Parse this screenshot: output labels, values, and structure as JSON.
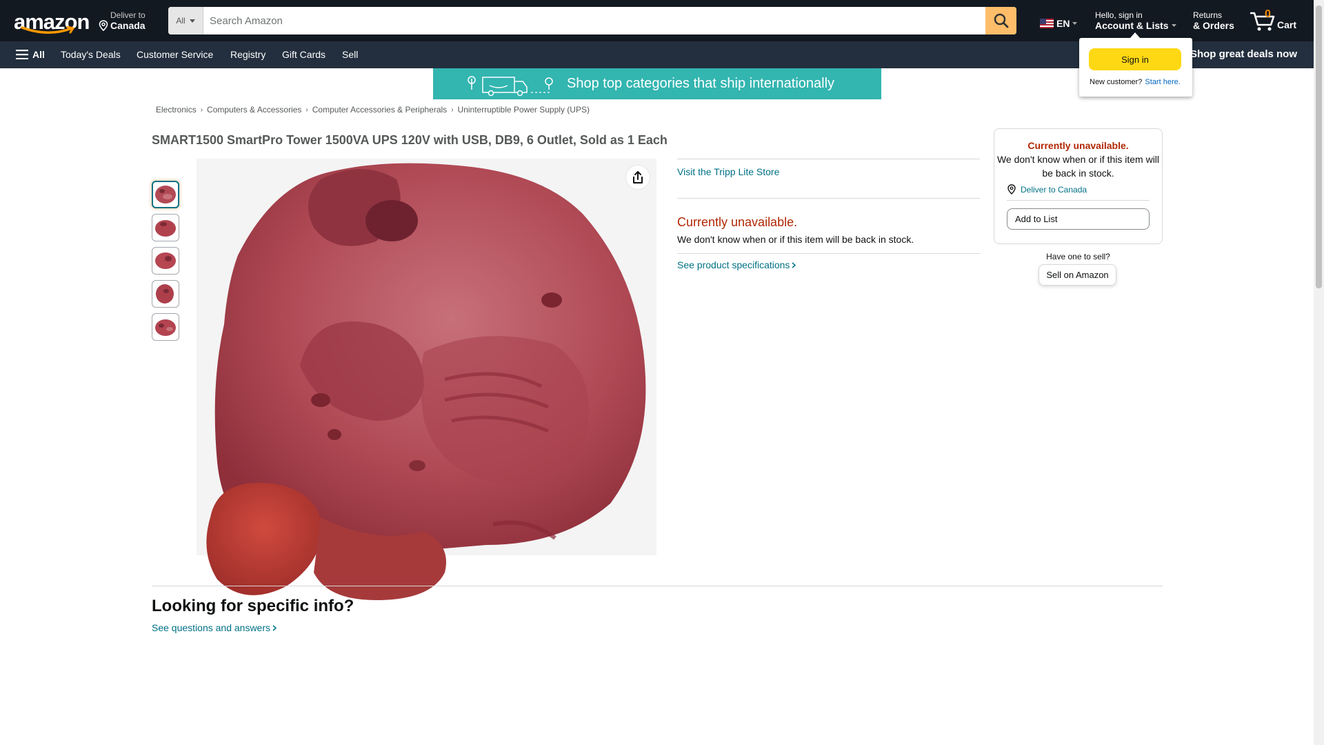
{
  "nav": {
    "logo_text": "amazon",
    "deliver_line1": "Deliver to",
    "deliver_line2": "Canada",
    "search_category": "All",
    "search_placeholder": "Search Amazon",
    "language": "EN",
    "account_line1": "Hello, sign in",
    "account_line2": "Account & Lists",
    "returns_line1": "Returns",
    "returns_line2": "& Orders",
    "cart_count": "0",
    "cart_label": "Cart"
  },
  "subnav": {
    "all_label": "All",
    "items": [
      "Today's Deals",
      "Customer Service",
      "Registry",
      "Gift Cards",
      "Sell"
    ],
    "promo": "Shop great deals now"
  },
  "banner": {
    "text": "Shop top categories that ship internationally"
  },
  "breadcrumb": [
    "Electronics",
    "Computers & Accessories",
    "Computer Accessories & Peripherals",
    "Uninterruptible Power Supply (UPS)"
  ],
  "product": {
    "title": "SMART1500 SmartPro Tower 1500VA UPS 120V with USB, DB9, 6 Outlet, Sold as 1 Each",
    "store_link": "Visit the Tripp Lite Store",
    "unavailable": "Currently unavailable.",
    "unavailable_note": "We don't know when or if this item will be back in stock.",
    "spec_link": "See product specifications"
  },
  "buybox": {
    "unavailable": "Currently unavailable.",
    "note": "We don't know when or if this item will be back in stock.",
    "deliver_link": "Deliver to Canada",
    "add_to_list": "Add to List",
    "sell_question": "Have one to sell?",
    "sell_button": "Sell on Amazon"
  },
  "lower": {
    "heading": "Looking for specific info?",
    "qa_link": "See questions and answers"
  },
  "flyout": {
    "sign_in": "Sign in",
    "new_customer": "New customer?",
    "start_here": "Start here."
  },
  "colors": {
    "nav_bg": "#131921",
    "subnav_bg": "#232f3e",
    "search_button": "#febd69",
    "link": "#007185",
    "unavailable": "#b12704",
    "signin_button": "#ffd814",
    "banner_bg": "#33b5b0"
  },
  "icons": [
    "location-pin-icon",
    "search-icon",
    "us-flag-icon",
    "cart-icon",
    "hamburger-icon",
    "share-icon",
    "truck-icon"
  ]
}
